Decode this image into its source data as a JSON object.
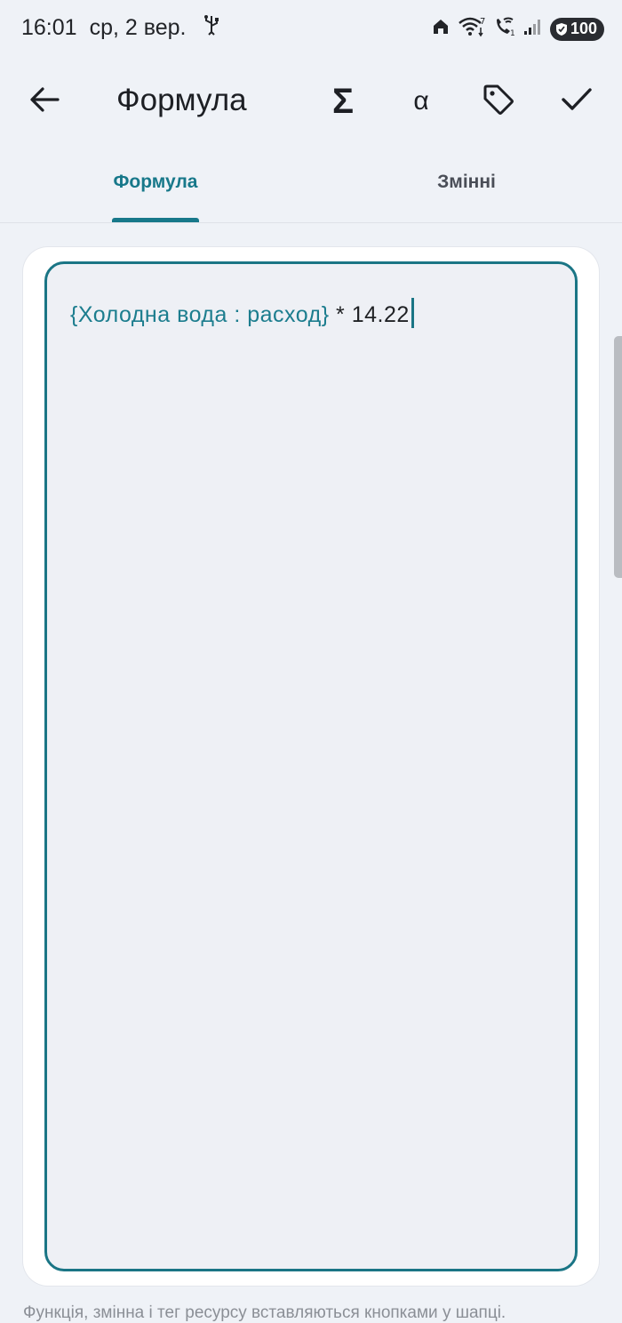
{
  "status_bar": {
    "time": "16:01",
    "date": "ср, 2 вер.",
    "battery": "100",
    "icons": [
      "usb-icon",
      "home-icon",
      "wifi-icon",
      "wifi-call-icon",
      "signal-icon",
      "battery-icon"
    ]
  },
  "app_bar": {
    "title": "Формула",
    "sigma": "Σ",
    "alpha": "α",
    "icons": [
      "back-arrow-icon",
      "sigma-icon",
      "alpha-icon",
      "tag-icon",
      "check-icon"
    ]
  },
  "tabs": [
    {
      "label": "Формула",
      "selected": true
    },
    {
      "label": "Змінні",
      "selected": false
    }
  ],
  "editor": {
    "variable_token": "{Холодна вода : расход}",
    "expression": " * 14.22"
  },
  "hint": "Функція, змінна і тег ресурсу вставляються кнопками у шапці.",
  "colors": {
    "accent": "#17788a",
    "background": "#eff2f7",
    "editor_bg": "#eef0f5"
  }
}
